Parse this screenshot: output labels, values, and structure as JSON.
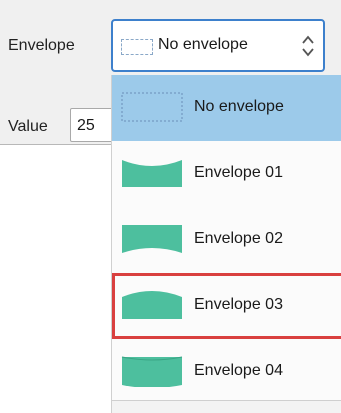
{
  "envelope": {
    "label": "Envelope",
    "selected_value": "No envelope"
  },
  "value": {
    "label": "Value",
    "current": "25"
  },
  "dropdown": {
    "items": [
      {
        "label": "No envelope",
        "icon": "no-envelope-icon",
        "state": "selected"
      },
      {
        "label": "Envelope 01",
        "icon": "envelope-01-icon",
        "state": "normal"
      },
      {
        "label": "Envelope 02",
        "icon": "envelope-02-icon",
        "state": "normal"
      },
      {
        "label": "Envelope 03",
        "icon": "envelope-03-icon",
        "state": "highlighted"
      },
      {
        "label": "Envelope 04",
        "icon": "envelope-04-icon",
        "state": "normal"
      }
    ]
  },
  "colors": {
    "envelope_fill": "#4dbf9e",
    "selected_row": "#9ccaea",
    "highlight_outline": "#d9403f",
    "focus_border": "#3d80cc"
  }
}
